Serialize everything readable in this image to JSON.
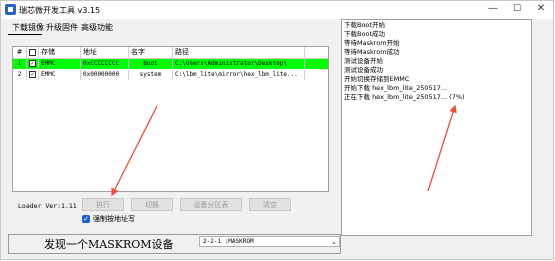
{
  "window": {
    "title": "瑞芯微开发工具 v3.15",
    "minimize": "—",
    "maximize": "☐",
    "close": "✕"
  },
  "tabs": [
    "下载镜像",
    "升级固件",
    "高级功能"
  ],
  "table": {
    "headers": [
      "#",
      "",
      "存储",
      "地址",
      "名字",
      "路径",
      ""
    ],
    "rows": [
      {
        "num": "1",
        "checked": true,
        "storage": "EMMC",
        "address": "0xCCCCCCCC",
        "name": "Boot",
        "path": "C:\\Users\\Administrator\\Desktop\\",
        "highlight": true
      },
      {
        "num": "2",
        "checked": true,
        "storage": "EMMC",
        "address": "0x00000000",
        "name": "system",
        "path": "C:\\lbm_lite\\mirror\\hex_lbm_lite...",
        "highlight": false
      }
    ]
  },
  "loader_version": "Loader Ver:1.11",
  "buttons": [
    "执行",
    "切换",
    "设备分区表",
    "清空"
  ],
  "force_write": {
    "label": "强制按地址写",
    "checked": true
  },
  "status_text": "发现一个MASKROM设备",
  "device_select": "2-2-1 :MASKROM",
  "log_lines": [
    "下载Boot开始",
    "下载Boot成功",
    "等待Maskrom开始",
    "等待Maskrom成功",
    "测试设备开始",
    "测试设备成功",
    "开始切换存储到EMMC",
    "开始下载 hex_lbm_lite_250517...",
    "正在下载 hex_lbm_lite_250517... (7%)"
  ],
  "colors": {
    "highlight_row": "#00ff00",
    "arrow": "#e8503a",
    "checkbox": "#1e62c9"
  }
}
